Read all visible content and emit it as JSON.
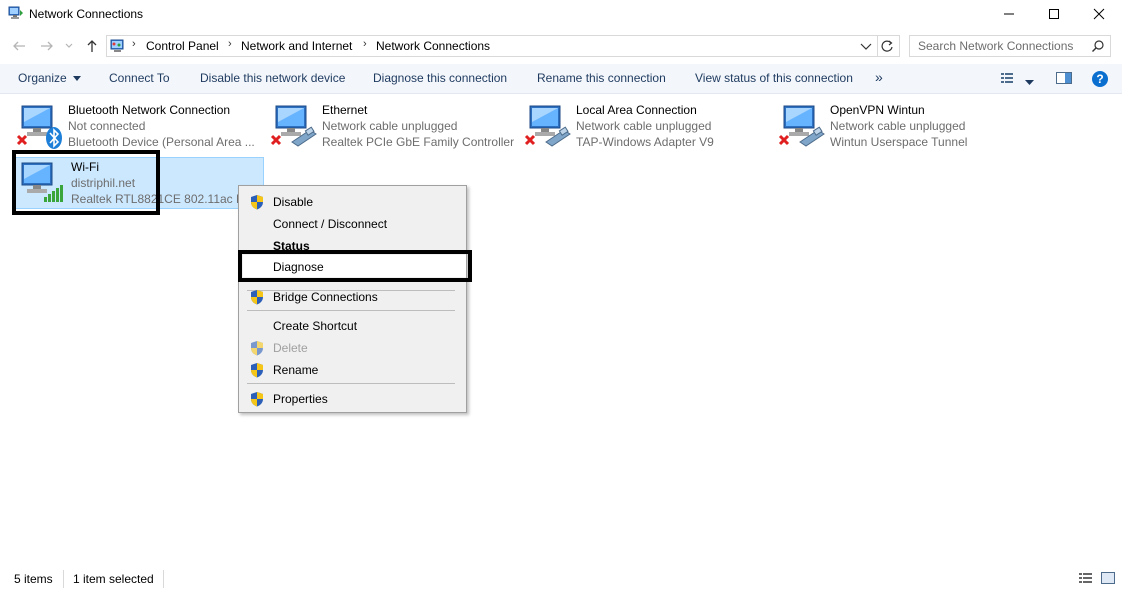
{
  "window": {
    "title": "Network Connections"
  },
  "address": {
    "breadcrumbs": [
      "Control Panel",
      "Network and Internet",
      "Network Connections"
    ],
    "search_placeholder": "Search Network Connections"
  },
  "toolbar": {
    "organize": "Organize",
    "connect_to": "Connect To",
    "disable": "Disable this network device",
    "diagnose": "Diagnose this connection",
    "rename": "Rename this connection",
    "view_status": "View status of this connection",
    "more": "»"
  },
  "items": [
    {
      "name": "Bluetooth Network Connection",
      "status": "Not connected",
      "device": "Bluetooth Device (Personal Area ...",
      "icon": "bluetooth-adapter-icon"
    },
    {
      "name": "Ethernet",
      "status": "Network cable unplugged",
      "device": "Realtek PCIe GbE Family Controller",
      "icon": "ethernet-adapter-icon"
    },
    {
      "name": "Local Area Connection",
      "status": "Network cable unplugged",
      "device": "TAP-Windows Adapter V9",
      "icon": "lan-adapter-icon"
    },
    {
      "name": "OpenVPN Wintun",
      "status": "Network cable unplugged",
      "device": "Wintun Userspace Tunnel",
      "icon": "vpn-adapter-icon"
    },
    {
      "name": "Wi-Fi",
      "status": "distriphil.net",
      "device": "Realtek RTL8821CE 802.11ac PCIe",
      "icon": "wifi-adapter-icon"
    }
  ],
  "context_menu": {
    "disable": "Disable",
    "connect": "Connect / Disconnect",
    "status": "Status",
    "diagnose": "Diagnose",
    "bridge": "Bridge Connections",
    "shortcut": "Create Shortcut",
    "delete": "Delete",
    "rename": "Rename",
    "properties": "Properties"
  },
  "statusbar": {
    "count": "5 items",
    "selected": "1 item selected"
  },
  "colors": {
    "accent": "#0078d7",
    "selection": "#cce8ff",
    "command_text": "#1e3a5f",
    "disabled_text": "#a0a0a0"
  }
}
